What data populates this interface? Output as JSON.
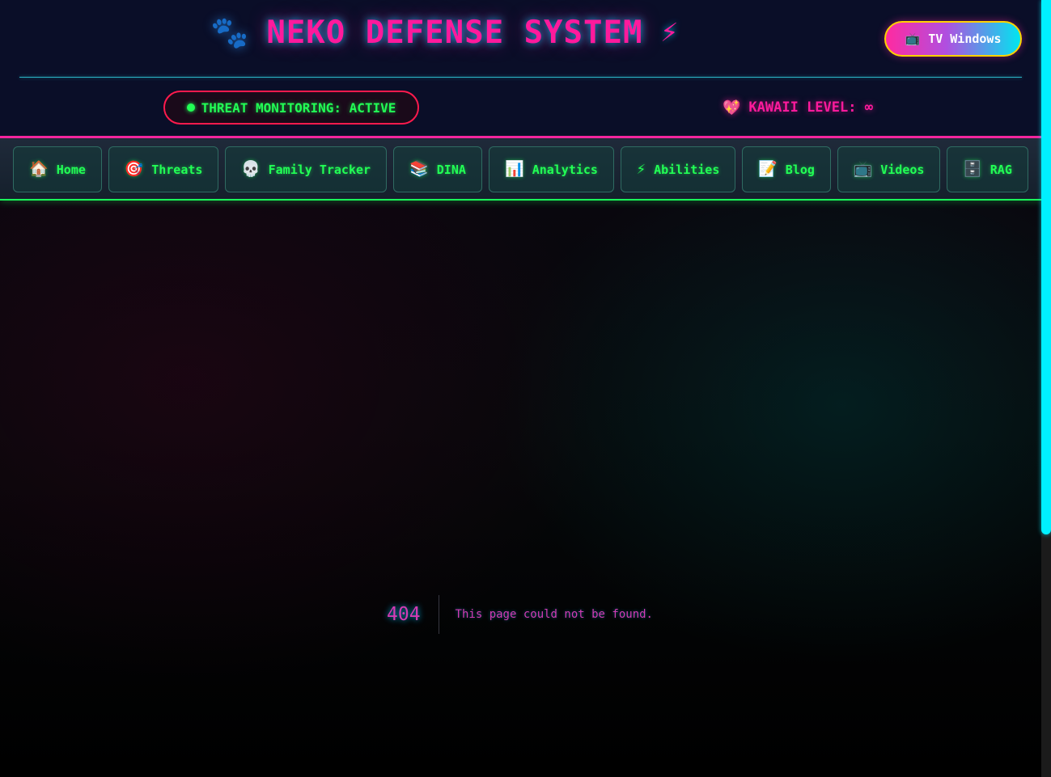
{
  "header": {
    "paw_icon": "paw-prints-icon",
    "title": "NEKO DEFENSE SYSTEM",
    "title_icon": "lightning-bolt-icon",
    "tv_button": {
      "icon": "television-icon",
      "glyph": "📺",
      "label": "TV Windows"
    },
    "threat_status": "THREAT MONITORING: ACTIVE",
    "kawaii": {
      "icon": "sparkling-heart-icon",
      "glyph": "💖",
      "label": "KAWAII LEVEL: ∞"
    }
  },
  "nav": {
    "items": [
      {
        "id": "home",
        "icon": "house-icon",
        "glyph": "🏠",
        "label": "Home"
      },
      {
        "id": "threats",
        "icon": "target-icon",
        "glyph": "🎯",
        "label": "Threats"
      },
      {
        "id": "family-tracker",
        "icon": "skull-icon",
        "glyph": "💀",
        "label": "Family Tracker"
      },
      {
        "id": "dina",
        "icon": "books-icon",
        "glyph": "📚",
        "label": "DINA"
      },
      {
        "id": "analytics",
        "icon": "bar-chart-icon",
        "glyph": "📊",
        "label": "Analytics"
      },
      {
        "id": "abilities",
        "icon": "lightning-bolt-icon",
        "glyph": "⚡",
        "label": "Abilities"
      },
      {
        "id": "blog",
        "icon": "memo-icon",
        "glyph": "📝",
        "label": "Blog"
      },
      {
        "id": "videos",
        "icon": "television-icon",
        "glyph": "📺",
        "label": "Videos"
      },
      {
        "id": "rag",
        "icon": "file-cabinet-icon",
        "glyph": "🗄️",
        "label": "RAG"
      }
    ]
  },
  "error": {
    "code": "404",
    "message": "This page could not be found."
  },
  "colors": {
    "accent_pink": "#ff1a9c",
    "accent_green": "#22ff55",
    "accent_cyan": "#00f0ff",
    "header_bg": "#0a0e28"
  }
}
